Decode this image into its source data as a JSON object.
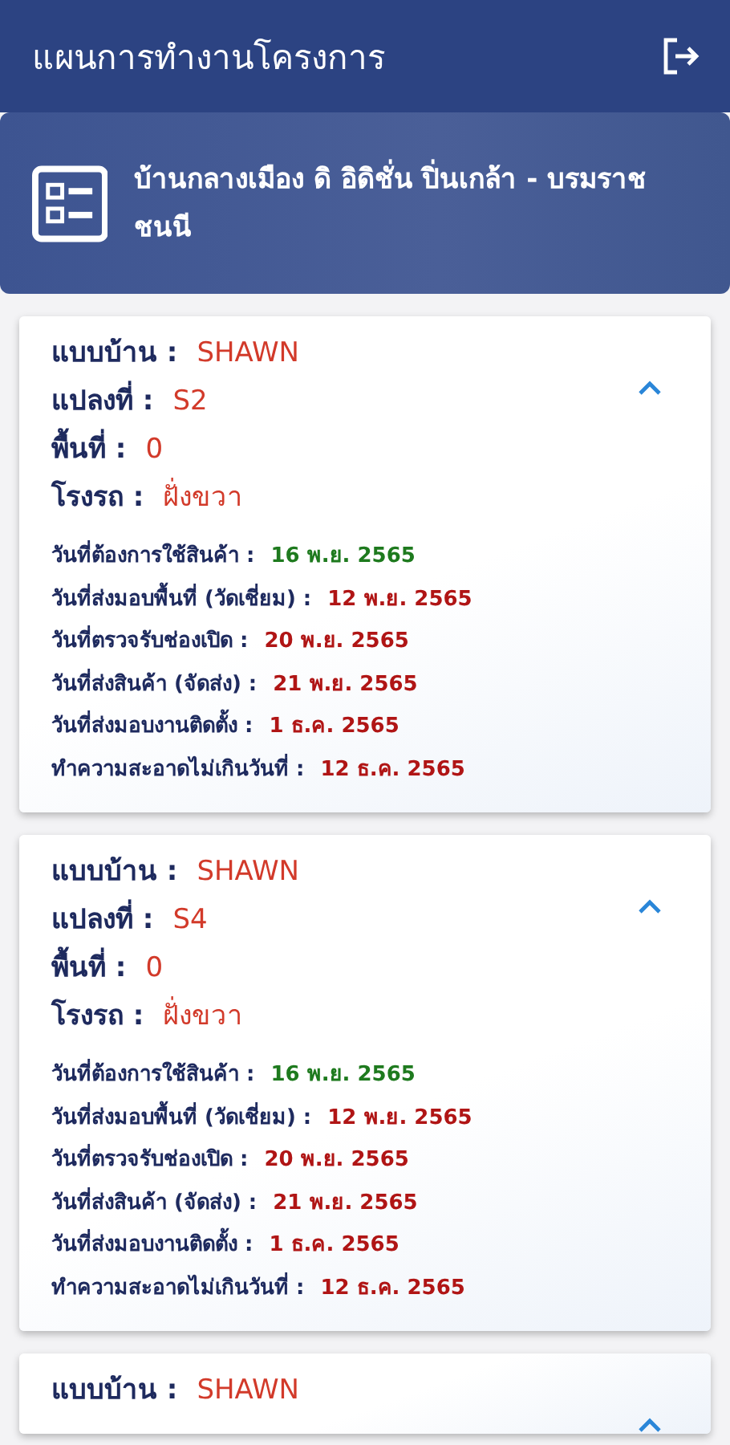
{
  "app_bar": {
    "title": "แผนการทำงานโครงการ"
  },
  "project_banner": {
    "name": "บ้านกลางเมือง ดิ อิดิชั่น ปิ่นเกล้า - บรมราชชนนี"
  },
  "cards": [
    {
      "expanded": true,
      "fields": [
        {
          "label": "แบบบ้าน :",
          "value": "SHAWN"
        },
        {
          "label": "แปลงที่ :",
          "value": "S2"
        },
        {
          "label": "พื้นที่ :",
          "value": "0"
        },
        {
          "label": "โรงรถ :",
          "value": "ฝั่งขวา"
        }
      ],
      "dates": [
        {
          "label": "วันที่ต้องการใช้สินค้า :",
          "value": "16 พ.ย. 2565",
          "color": "#1e7a1e"
        },
        {
          "label": "วันที่ส่งมอบพื้นที่ (วัดเชี่ยม) :",
          "value": "12 พ.ย. 2565",
          "color": "#b01515"
        },
        {
          "label": "วันที่ตรวจรับช่องเปิด :",
          "value": "20 พ.ย. 2565",
          "color": "#b01515"
        },
        {
          "label": "วันที่ส่งสินค้า (จัดส่ง) :",
          "value": "21 พ.ย. 2565",
          "color": "#b01515"
        },
        {
          "label": "วันที่ส่งมอบงานติดตั้ง :",
          "value": "1 ธ.ค. 2565",
          "color": "#b01515"
        },
        {
          "label": "ทำความสะอาดไม่เกินวันที่ :",
          "value": "12 ธ.ค. 2565",
          "color": "#b01515"
        }
      ]
    },
    {
      "expanded": true,
      "fields": [
        {
          "label": "แบบบ้าน :",
          "value": "SHAWN"
        },
        {
          "label": "แปลงที่ :",
          "value": "S4"
        },
        {
          "label": "พื้นที่ :",
          "value": "0"
        },
        {
          "label": "โรงรถ :",
          "value": "ฝั่งขวา"
        }
      ],
      "dates": [
        {
          "label": "วันที่ต้องการใช้สินค้า :",
          "value": "16 พ.ย. 2565",
          "color": "#1e7a1e"
        },
        {
          "label": "วันที่ส่งมอบพื้นที่ (วัดเชี่ยม) :",
          "value": "12 พ.ย. 2565",
          "color": "#b01515"
        },
        {
          "label": "วันที่ตรวจรับช่องเปิด :",
          "value": "20 พ.ย. 2565",
          "color": "#b01515"
        },
        {
          "label": "วันที่ส่งสินค้า (จัดส่ง) :",
          "value": "21 พ.ย. 2565",
          "color": "#b01515"
        },
        {
          "label": "วันที่ส่งมอบงานติดตั้ง :",
          "value": "1 ธ.ค. 2565",
          "color": "#b01515"
        },
        {
          "label": "ทำความสะอาดไม่เกินวันที่ :",
          "value": "12 ธ.ค. 2565",
          "color": "#b01515"
        }
      ]
    },
    {
      "expanded": true,
      "fields": [
        {
          "label": "แบบบ้าน :",
          "value": "SHAWN"
        }
      ]
    }
  ]
}
